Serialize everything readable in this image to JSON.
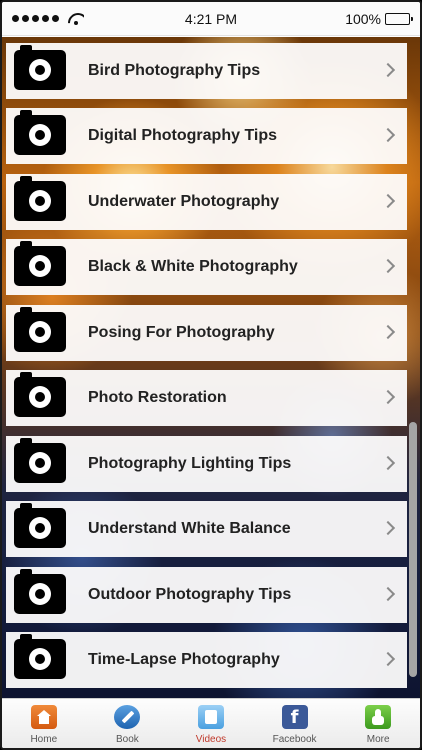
{
  "status_bar": {
    "time": "4:21 PM",
    "battery": "100%"
  },
  "list": {
    "items": [
      {
        "label": "Bird Photography Tips",
        "icon": "camera-icon"
      },
      {
        "label": "Digital Photography Tips",
        "icon": "camera-icon"
      },
      {
        "label": "Underwater Photography",
        "icon": "camera-icon"
      },
      {
        "label": "Black & White Photography",
        "icon": "camera-icon"
      },
      {
        "label": "Posing For Photography",
        "icon": "camera-icon"
      },
      {
        "label": "Photo Restoration",
        "icon": "camera-icon"
      },
      {
        "label": "Photography Lighting Tips",
        "icon": "camera-icon"
      },
      {
        "label": "Understand White Balance",
        "icon": "camera-icon"
      },
      {
        "label": "Outdoor Photography Tips",
        "icon": "camera-icon"
      },
      {
        "label": "Time-Lapse Photography",
        "icon": "camera-icon"
      }
    ]
  },
  "tab_bar": {
    "active_color": "#c0392b",
    "tabs": [
      {
        "label": "Home",
        "icon": "home-icon"
      },
      {
        "label": "Book",
        "icon": "book-icon"
      },
      {
        "label": "Videos",
        "icon": "videos-icon",
        "active": true
      },
      {
        "label": "Facebook",
        "icon": "facebook-icon",
        "glyph": "f"
      },
      {
        "label": "More",
        "icon": "more-icon"
      }
    ]
  }
}
